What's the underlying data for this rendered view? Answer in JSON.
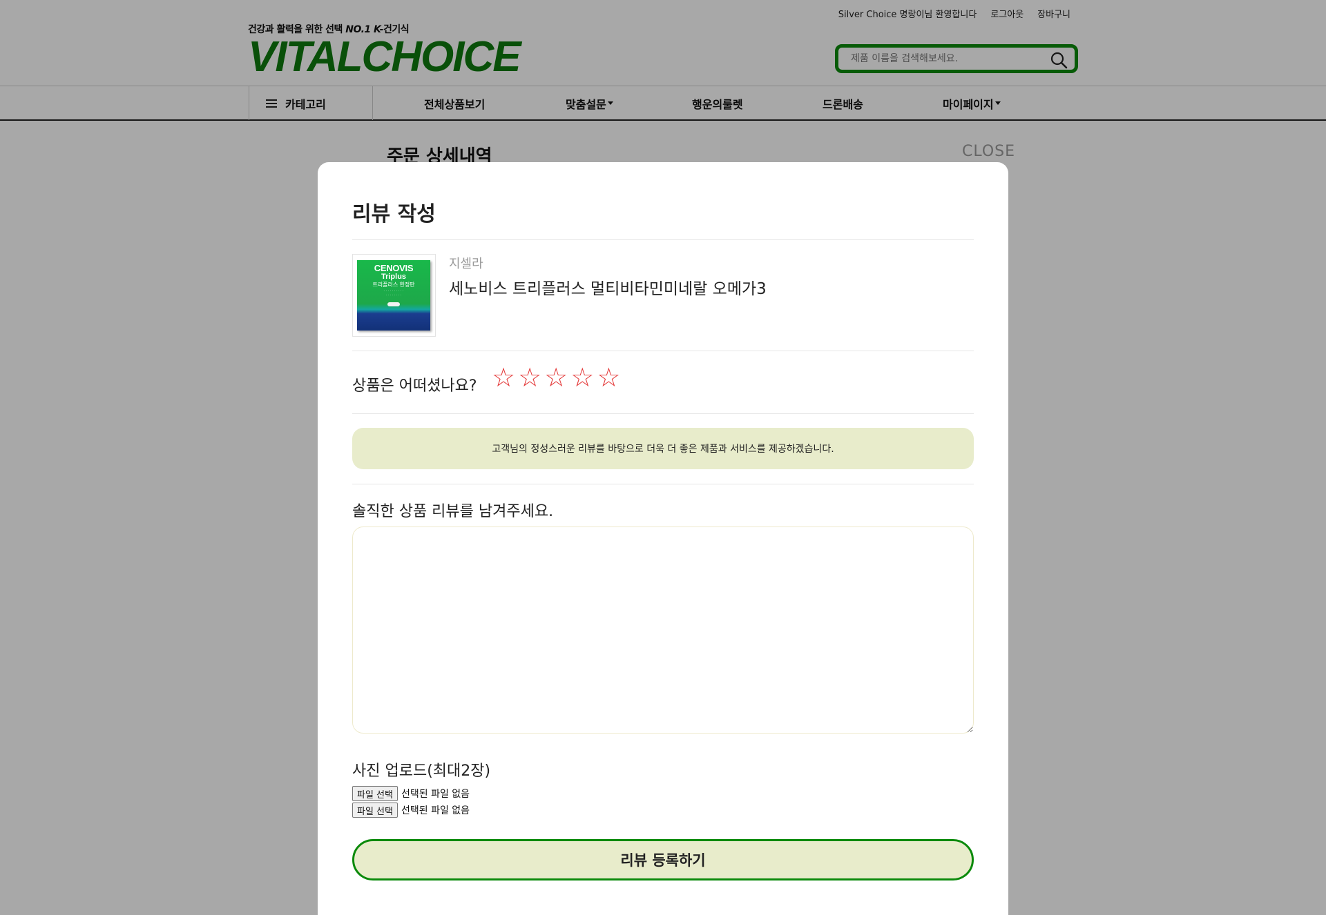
{
  "header": {
    "welcome": "Silver Choice 명랑이님 환영합니다",
    "logout": "로그아웃",
    "cart": "장바구니",
    "tagline_pre": "건강과 활력을 위한 선택 ",
    "tagline_no1": "NO.1 K-",
    "tagline_post": "건기식",
    "logo": "VITALCHOICE",
    "search_placeholder": "제품 이름을 검색해보세요."
  },
  "nav": {
    "category": "카테고리",
    "items": [
      {
        "label": "전체상품보기"
      },
      {
        "label": "맞춤설문"
      },
      {
        "label": "행운의룰렛"
      },
      {
        "label": "드론배송"
      },
      {
        "label": "마이페이지"
      }
    ]
  },
  "background": {
    "order_title": "주문 상세내역",
    "close": "CLOSE"
  },
  "modal": {
    "title": "리뷰 작성",
    "product": {
      "brand": "지셀라",
      "name": "세노비스 트리플러스 멀티비타민미네랄 오메가3",
      "package_brand": "CENOVIS",
      "package_sub": "Triplus",
      "package_ko": "트리플러스 한정판"
    },
    "rating_question": "상품은 어떠셨나요?",
    "rating": 0,
    "rating_max": 5,
    "star_glyph": "☆",
    "notice": "고객님의 정성스러운 리뷰를 바탕으로 더욱 더 좋은 제품과 서비스를 제공하겠습니다.",
    "review_label": "솔직한 상품 리뷰를 남겨주세요.",
    "review_value": "",
    "photo_label": "사진 업로드(최대2장)",
    "file_button": "파일 선택",
    "file_status": "선택된 파일 없음",
    "submit": "리뷰 등록하기"
  },
  "colors": {
    "brand_green": "#0b8a0b",
    "notice_bg": "#e8eccb",
    "star_red": "#e43b3b"
  }
}
